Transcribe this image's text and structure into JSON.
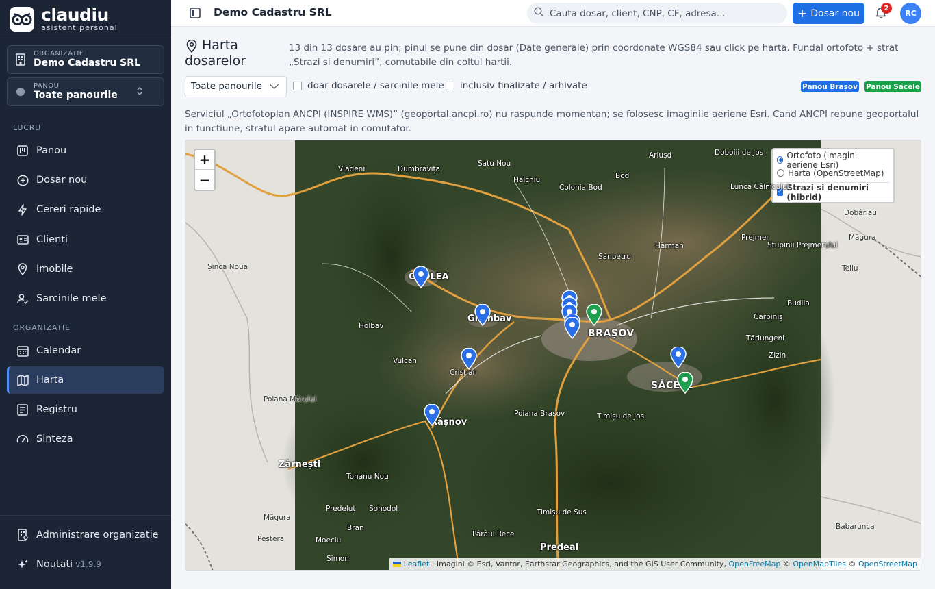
{
  "brand": {
    "name": "claudiu",
    "tagline": "asistent personal"
  },
  "org_selector": {
    "label": "ORGANIZATIE",
    "value": "Demo Cadastru SRL"
  },
  "panel_selector": {
    "label": "PANOU",
    "value": "Toate panourile"
  },
  "nav": {
    "section_work": "LUCRU",
    "section_org": "ORGANIZATIE",
    "items": [
      {
        "label": "Panou",
        "icon": "kanban-icon"
      },
      {
        "label": "Dosar nou",
        "icon": "plus-circle-icon"
      },
      {
        "label": "Cereri rapide",
        "icon": "lightning-icon"
      },
      {
        "label": "Clienti",
        "icon": "id-card-icon"
      },
      {
        "label": "Imobile",
        "icon": "map-pin-icon"
      },
      {
        "label": "Sarcinile mele",
        "icon": "user-check-icon"
      },
      {
        "label": "Calendar",
        "icon": "calendar-icon"
      },
      {
        "label": "Harta",
        "icon": "map-icon",
        "active": true
      },
      {
        "label": "Registru",
        "icon": "list-icon"
      },
      {
        "label": "Sinteza",
        "icon": "gauge-icon"
      }
    ],
    "admin": "Administrare organizatie",
    "news": "Noutati",
    "version": "v1.9.9"
  },
  "topbar": {
    "org_title": "Demo Cadastru SRL",
    "search_placeholder": "Cauta dosar, client, CNP, CF, adresa...",
    "new_button": "Dosar nou",
    "notif_count": "2",
    "avatar": "RC"
  },
  "page": {
    "title": "Harta dosarelor",
    "info": "13 din 13 dosare au pin; pinul se pune din dosar (Date generale) prin coordonate WGS84 sau click pe harta. Fundal ortofoto + strat „Strazi si denumiri”, comutabile din coltul hartii.",
    "panel_filter": "Toate panourile",
    "only_mine": "doar dosarele / sarcinile mele",
    "include_finished": "inclusiv finalizate / arhivate",
    "legend": [
      {
        "label": "Panou Brașov",
        "color": "#1f6fe5"
      },
      {
        "label": "Panou Săcele",
        "color": "#16a34a"
      }
    ],
    "warning": "Serviciul „Ortofotoplan ANCPI (INSPIRE WMS)” (geoportal.ancpi.ro) nu raspunde momentan; se folosesc imaginile aeriene Esri. Cand ANCPI repune geoportalul in functiune, stratul apare automat in comutator."
  },
  "map": {
    "zoom_in": "+",
    "zoom_out": "−",
    "layers": {
      "ortho": "Ortofoto (imagini aeriene Esri)",
      "osm": "Harta (OpenStreetMap)",
      "streets": "Strazi si denumiri (hibrid)"
    },
    "attribution": {
      "leaflet": "Leaflet",
      "text": " | Imagini © Esri, Vantor, Earthstar Geographics, and the GIS User Community, ",
      "ofm": "OpenFreeMap",
      "omt": "OpenMapTiles",
      "osm": "OpenStreetMap"
    },
    "places": [
      {
        "name": "Vlădeni"
      },
      {
        "name": "Dumbrăvița"
      },
      {
        "name": "Satu Nou"
      },
      {
        "name": "Hălchiu"
      },
      {
        "name": "Colonia Bod"
      },
      {
        "name": "Bod"
      },
      {
        "name": "Ariușd"
      },
      {
        "name": "Dobolii de Jos"
      },
      {
        "name": "Lunca Câlnicului"
      },
      {
        "name": "Dobârlău"
      },
      {
        "name": "Hărman"
      },
      {
        "name": "Prejmer"
      },
      {
        "name": "Stupinii Prejmerului"
      },
      {
        "name": "Măgura"
      },
      {
        "name": "Sânpetru"
      },
      {
        "name": "Teliu"
      },
      {
        "name": "Șinca Nouă"
      },
      {
        "name": "CODLEA"
      },
      {
        "name": "Ghimbav"
      },
      {
        "name": "BRAȘOV"
      },
      {
        "name": "Budila"
      },
      {
        "name": "Holbav"
      },
      {
        "name": "Cărpiniș"
      },
      {
        "name": "Tărlungeni"
      },
      {
        "name": "Zizin"
      },
      {
        "name": "Vulcan"
      },
      {
        "name": "Cristian"
      },
      {
        "name": "SĂCELE"
      },
      {
        "name": "Polana Mărului"
      },
      {
        "name": "Poiana Brașov"
      },
      {
        "name": "Timișu de Jos"
      },
      {
        "name": "Râșnov"
      },
      {
        "name": "Zărnești"
      },
      {
        "name": "Tohanu Nou"
      },
      {
        "name": "Predeluț"
      },
      {
        "name": "Sohodol"
      },
      {
        "name": "Măgura"
      },
      {
        "name": "Timișu de Sus"
      },
      {
        "name": "Bran"
      },
      {
        "name": "Babarunca"
      },
      {
        "name": "Peștera"
      },
      {
        "name": "Moeciu"
      },
      {
        "name": "Pârâul Rece"
      },
      {
        "name": "Predeal"
      },
      {
        "name": "Șimon"
      }
    ]
  }
}
